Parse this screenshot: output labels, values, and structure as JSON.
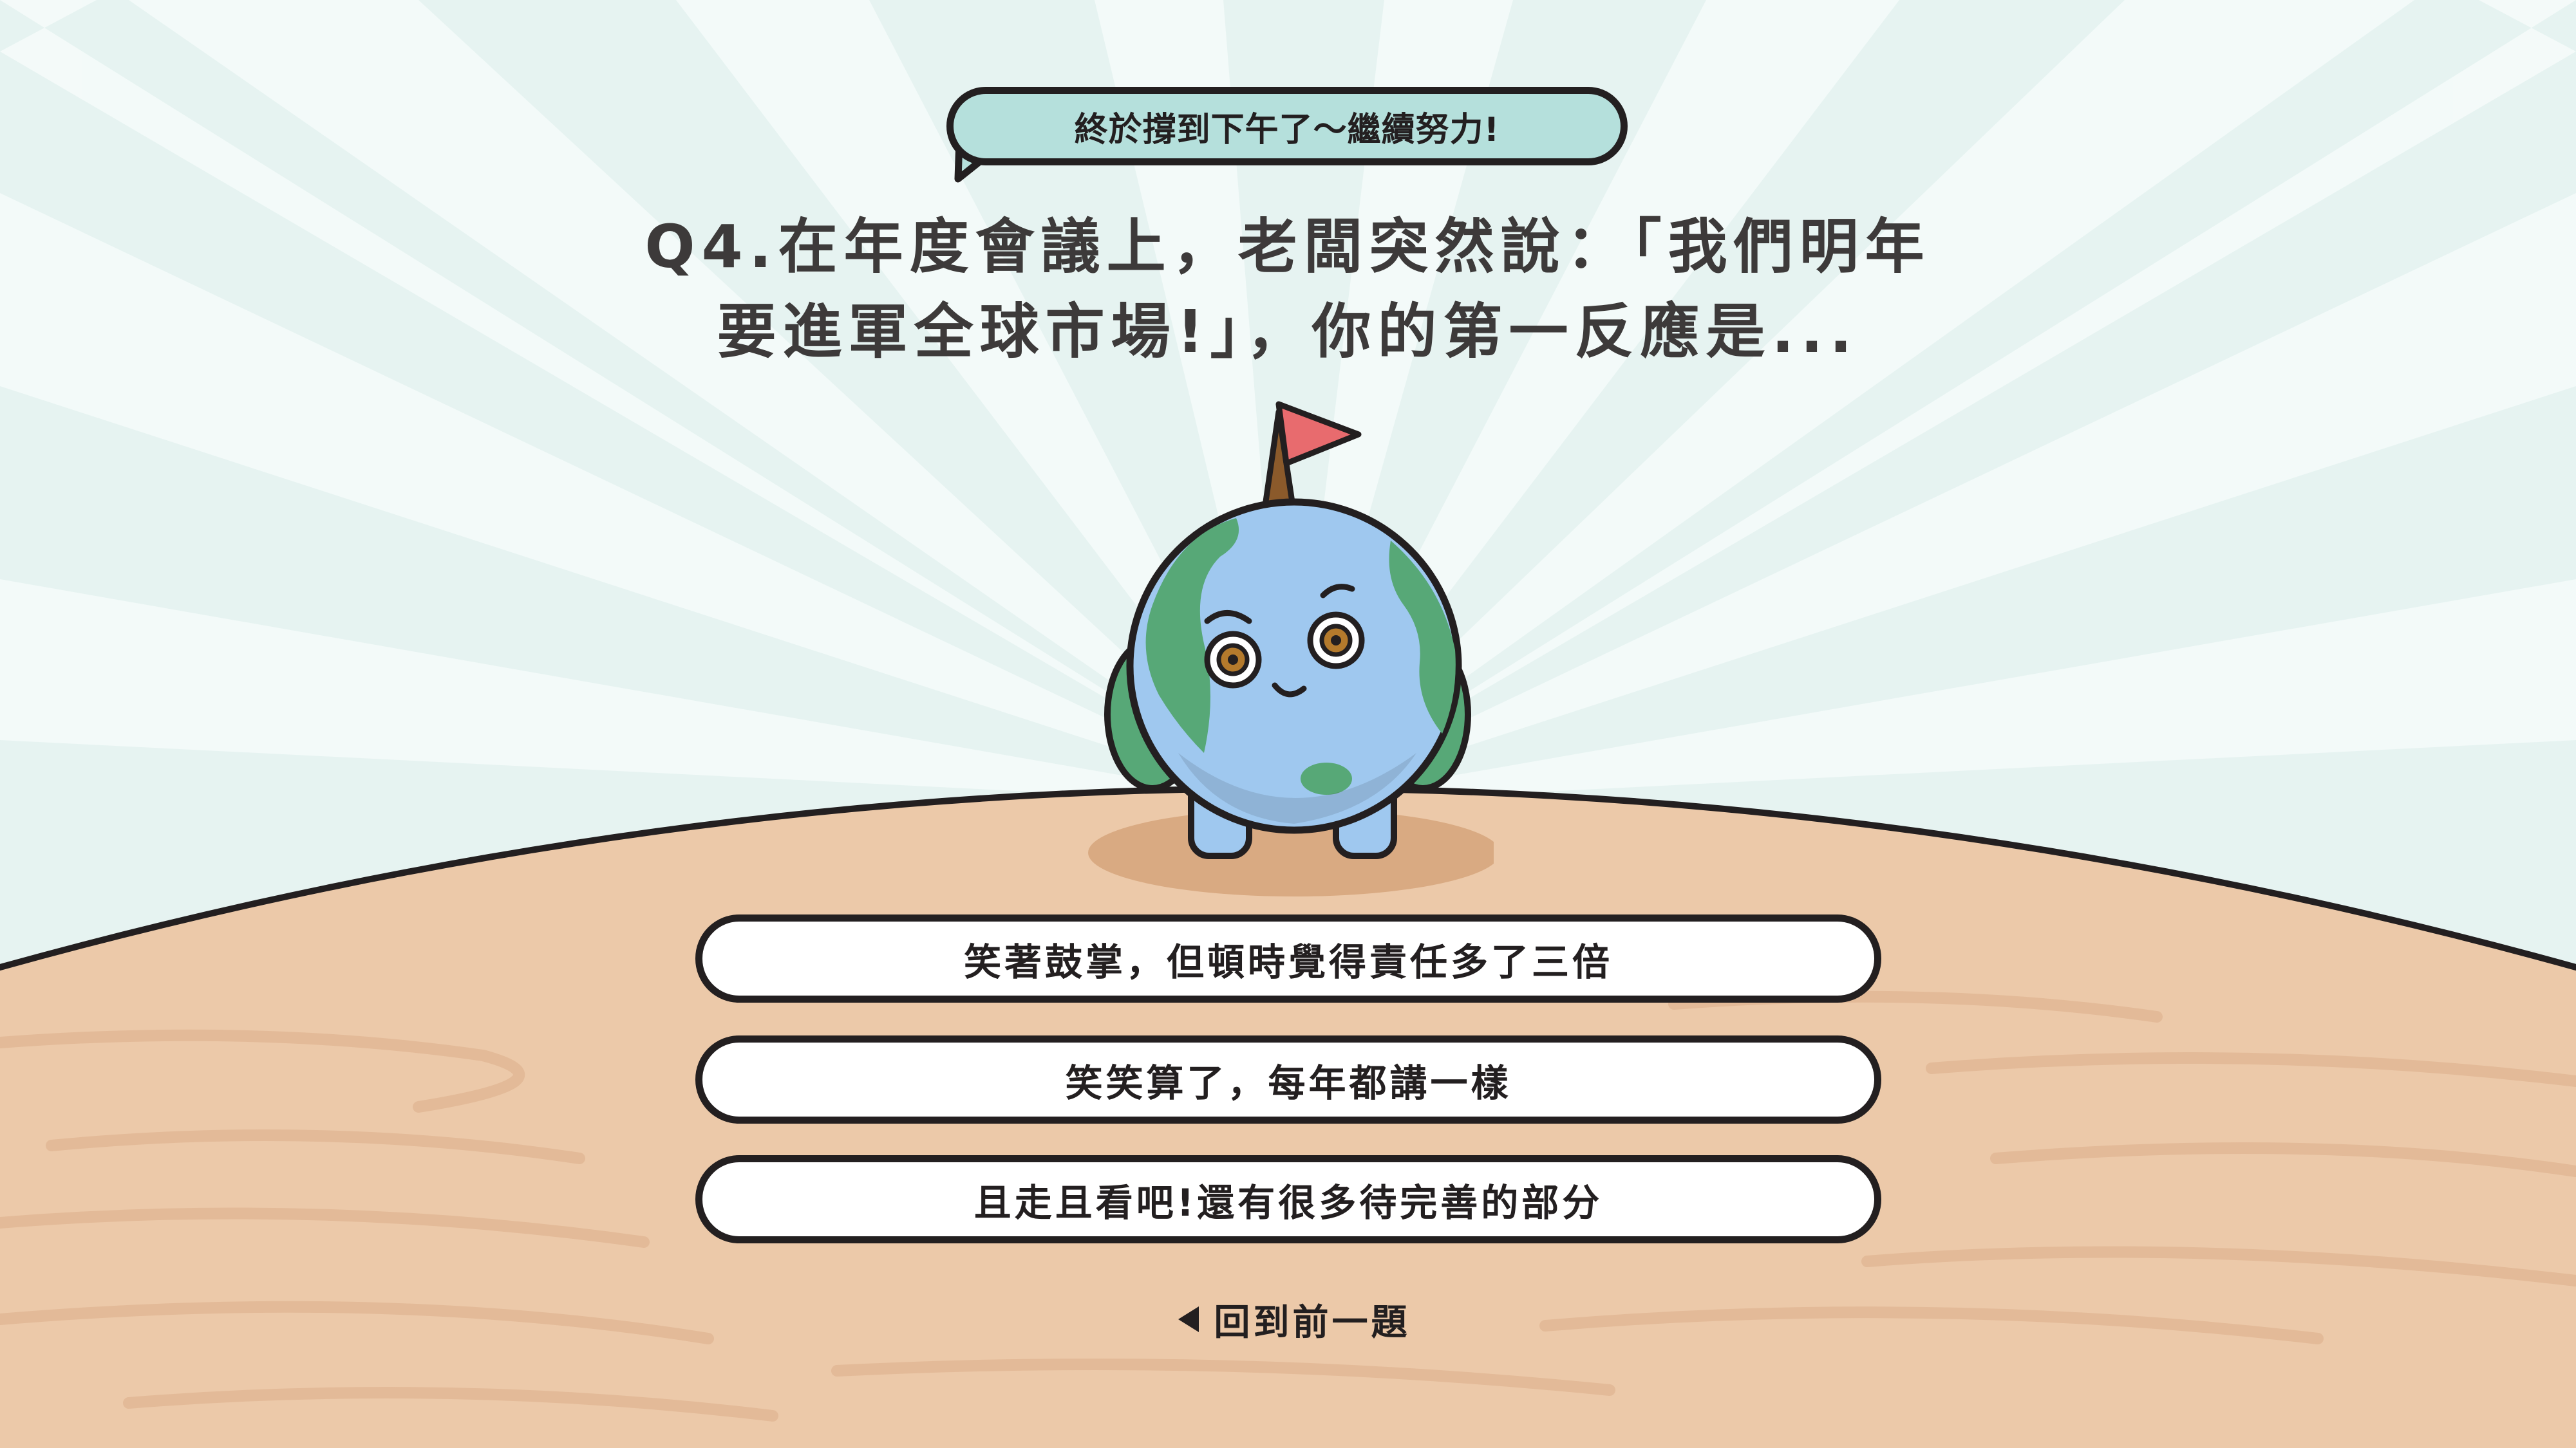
{
  "speech_bubble": {
    "text": "終於撐到下午了～繼續努力!"
  },
  "question": {
    "line1": "Q4.在年度會議上，老闆突然說：「我們明年",
    "line2": "要進軍全球市場!」，你的第一反應是..."
  },
  "answers": [
    {
      "label": "笑著鼓掌，但頓時覺得責任多了三倍"
    },
    {
      "label": "笑笑算了，每年都講一樣"
    },
    {
      "label": "且走且看吧!還有很多待完善的部分"
    }
  ],
  "back_button": {
    "label": "回到前一題",
    "icon": "triangle-left-icon"
  },
  "colors": {
    "sky": "#e6f3f1",
    "bubble": "#b5e0dc",
    "ground": "#ecc9a9",
    "outline": "#231f20",
    "globe_ocean": "#9fc8ef",
    "globe_land": "#57a877",
    "flag": "#e86b6e"
  }
}
